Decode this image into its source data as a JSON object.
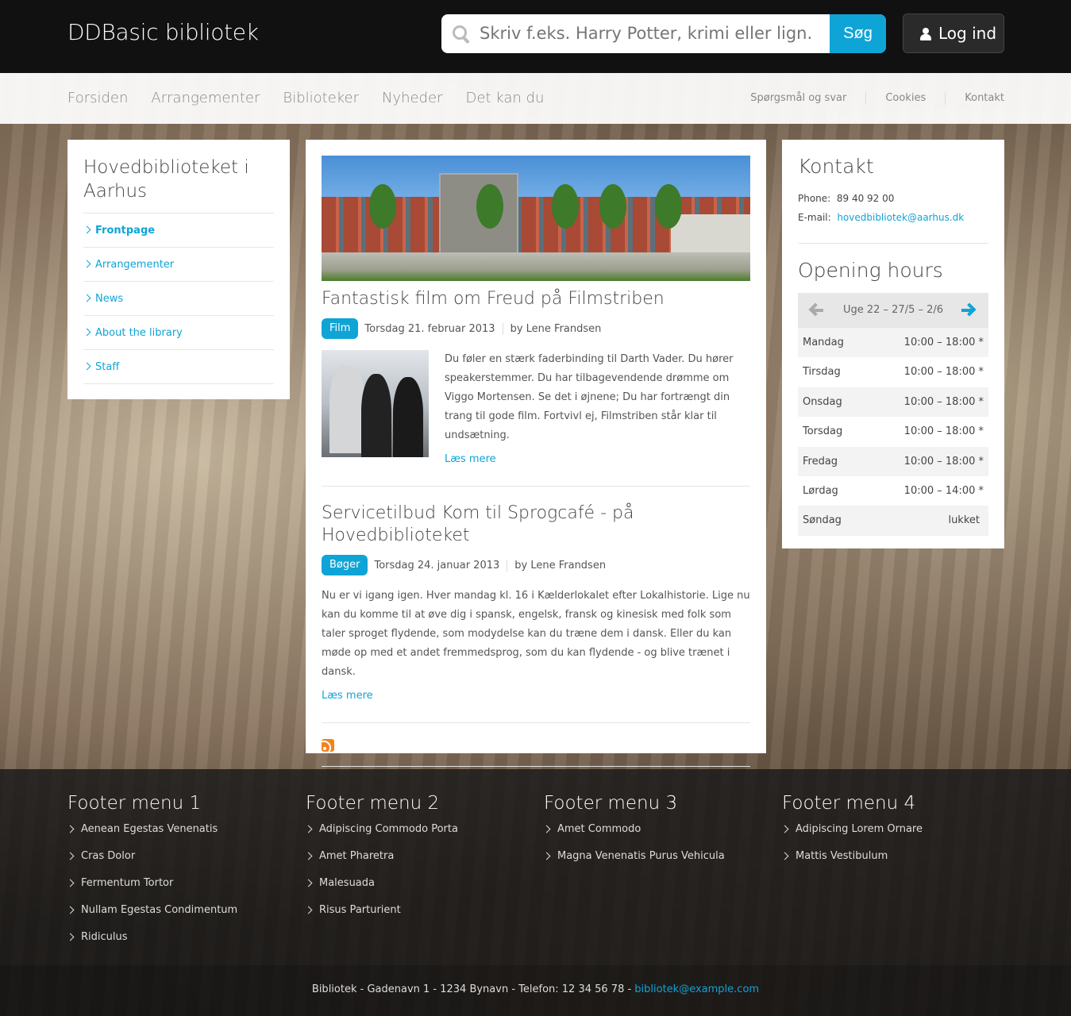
{
  "header": {
    "site_name": "DDBasic bibliotek",
    "search_placeholder": "Skriv f.eks. Harry Potter, krimi eller lign.",
    "search_button": "Søg",
    "login_label": "Log ind"
  },
  "mainnav": [
    "Forsiden",
    "Arrangementer",
    "Biblioteker",
    "Nyheder",
    "Det kan du"
  ],
  "secnav": [
    "Spørgsmål og svar",
    "Cookies",
    "Kontakt"
  ],
  "sidebar": {
    "title": "Hovedbiblioteket i Aarhus",
    "items": [
      "Frontpage",
      "Arrangementer",
      "News",
      "About the library",
      "Staff"
    ]
  },
  "articles": [
    {
      "title": "Fantastisk film om Freud på Filmstriben",
      "tag": "Film",
      "date": "Torsdag 21. februar 2013",
      "author": "by Lene Frandsen",
      "body": "Du føler en stærk faderbinding til Darth Vader. Du hører speakerstemmer. Du har tilbagevendende drømme om Viggo Mortensen. Se det i øjnene; Du har fortrængt din trang til gode film. Fortvivl ej, Filmstriben står klar til undsætning.",
      "readmore": "Læs mere"
    },
    {
      "title": "Servicetilbud Kom til Sprogcafé - på Hovedbiblioteket",
      "tag": "Bøger",
      "date": "Torsdag 24. januar 2013",
      "author": "by Lene Frandsen",
      "body": "Nu er vi igang igen. Hver mandag kl. 16 i Kælderlokalet efter Lokalhistorie. Lige nu kan du komme til at øve dig i spansk, engelsk, fransk og kinesisk med folk som taler sproget flydende, som modydelse kan du træne dem i dansk. Eller du kan møde op med et andet fremmedsprog, som du kan flydende - og blive trænet i dansk.",
      "readmore": "Læs mere"
    }
  ],
  "contact": {
    "title": "Kontakt",
    "phone_label": "Phone:",
    "phone": "89 40 92 00",
    "email_label": "E-mail:",
    "email": "hovedbibliotek@aarhus.dk"
  },
  "opening": {
    "title": "Opening hours",
    "week": "Uge 22 – 27/5 – 2/6",
    "days": [
      {
        "day": "Mandag",
        "hours": "10:00 – 18:00 *"
      },
      {
        "day": "Tirsdag",
        "hours": "10:00 – 18:00 *"
      },
      {
        "day": "Onsdag",
        "hours": "10:00 – 18:00 *"
      },
      {
        "day": "Torsdag",
        "hours": "10:00 – 18:00 *"
      },
      {
        "day": "Fredag",
        "hours": "10:00 – 18:00 *"
      },
      {
        "day": "Lørdag",
        "hours": "10:00 – 14:00 *"
      },
      {
        "day": "Søndag",
        "hours": "lukket"
      }
    ]
  },
  "footer": {
    "menus": [
      {
        "title": "Footer menu 1",
        "items": [
          "Aenean Egestas Venenatis",
          "Cras Dolor",
          "Fermentum Tortor",
          "Nullam Egestas Condimentum",
          "Ridiculus"
        ]
      },
      {
        "title": "Footer menu 2",
        "items": [
          "Adipiscing Commodo Porta",
          "Amet Pharetra",
          "Malesuada",
          "Risus Parturient"
        ]
      },
      {
        "title": "Footer menu 3",
        "items": [
          "Amet Commodo",
          "Magna Venenatis Purus Vehicula"
        ]
      },
      {
        "title": "Footer menu 4",
        "items": [
          "Adipiscing Lorem Ornare",
          "Mattis Vestibulum"
        ]
      }
    ],
    "address": "Bibliotek - Gadenavn 1 - 1234 Bynavn - Telefon: 12 34 56 78 - ",
    "email": "bibliotek@example.com"
  },
  "colors": {
    "accent": "#0fa4d6",
    "topbar": "#111111"
  }
}
